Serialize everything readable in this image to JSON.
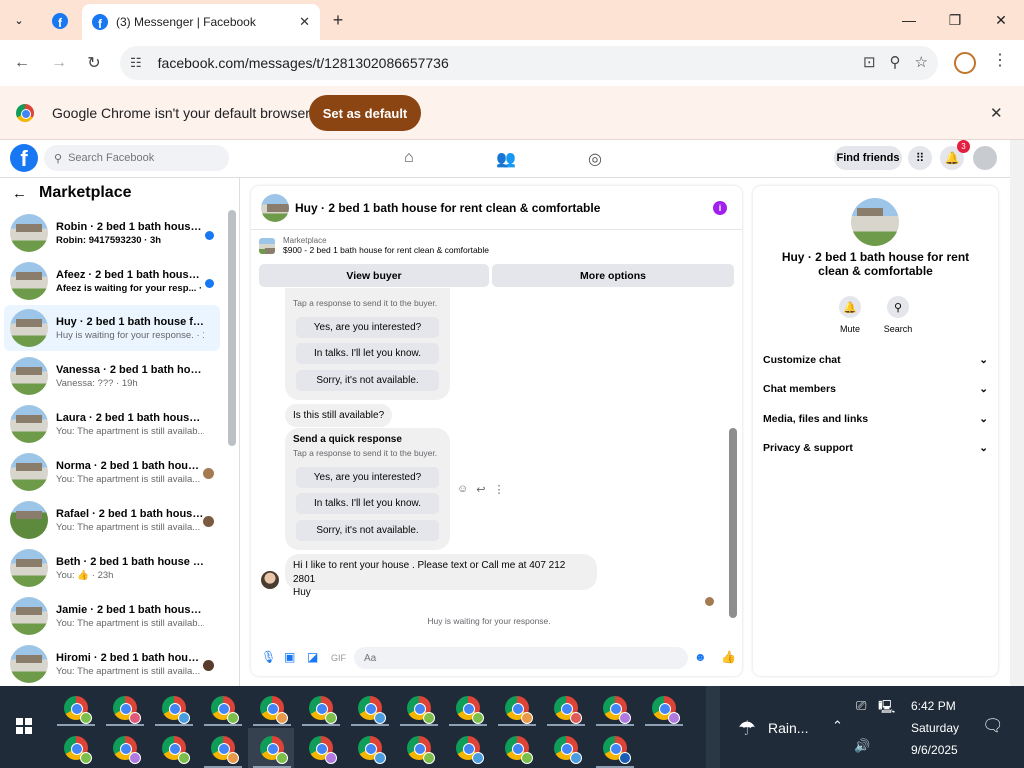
{
  "browser": {
    "tab_title": "(3) Messenger | Facebook",
    "url": "facebook.com/messages/t/1281302086657736",
    "infobar_text": "Google Chrome isn't your default browser",
    "set_default_label": "Set as default"
  },
  "facebook": {
    "search_placeholder": "Search Facebook",
    "find_friends_label": "Find friends",
    "notification_count": "3"
  },
  "sidebar": {
    "title": "Marketplace",
    "conversations": [
      {
        "name": "Robin · 2 bed 1 bath house fo...",
        "sub": "Robin: 9417593230 · 3h",
        "unread": true
      },
      {
        "name": "Afeez · 2 bed 1 bath house fo...",
        "sub": "Afeez is waiting for your resp... · 10h",
        "unread": true
      },
      {
        "name": "Huy · 2 bed 1 bath house for re...",
        "sub": "Huy is waiting for your response. · 11h",
        "unread": false
      },
      {
        "name": "Vanessa · 2 bed 1 bath house fo...",
        "sub": "Vanessa: ??? · 19h",
        "unread": false
      },
      {
        "name": "Laura · 2 bed 1 bath house for r...",
        "sub": "You: The apartment is still availab... · 23h",
        "unread": false
      },
      {
        "name": "Norma · 2 bed 1 bath house f...",
        "sub": "You: The apartment is still availa... · 23h",
        "unread": false
      },
      {
        "name": "Rafael · 2 bed 1 bath house f...",
        "sub": "You: The apartment is still availa... · 23h",
        "unread": false
      },
      {
        "name": "Beth · 2 bed 1 bath house for re...",
        "sub": "You: 👍 · 23h",
        "unread": false
      },
      {
        "name": "Jamie · 2 bed 1 bath house for r...",
        "sub": "You: The apartment is still availab... · 23h",
        "unread": false
      },
      {
        "name": "Hiromi · 2 bed 1 bath house f...",
        "sub": "You: The apartment is still availa... · 23h",
        "unread": false
      }
    ]
  },
  "chat": {
    "title": "Huy · 2 bed 1 bath house for rent clean & comfortable",
    "listing_label": "Marketplace",
    "listing_price": "$900 - 2 bed 1 bath house for rent clean & comfortable",
    "view_buyer_label": "View buyer",
    "more_options_label": "More options",
    "quick_title": "Send a quick response",
    "quick_sub": "Tap a response to send it to the buyer.",
    "quick_options": [
      "Yes, are you interested?",
      "In talks. I'll let you know.",
      "Sorry, it's not available."
    ],
    "still_available": "Is this still available?",
    "last_message_line1": "Hi I like to rent your house . Please text or Call me at 407 212 2801",
    "last_message_line2": "Huy",
    "waiting": "Huy is waiting for your response.",
    "composer_placeholder": "Aa"
  },
  "right_panel": {
    "title": "Huy · 2 bed 1 bath house for rent clean & comfortable",
    "mute_label": "Mute",
    "search_label": "Search",
    "sections": [
      "Customize chat",
      "Chat members",
      "Media, files and links",
      "Privacy & support"
    ]
  },
  "taskbar": {
    "weather": "Rain...",
    "time": "6:42 PM",
    "day": "Saturday",
    "date": "9/6/2025"
  },
  "colors": {
    "facebook_blue": "#1877f2",
    "set_default_bg": "#8b4513",
    "tabbar_bg": "#fde3d4",
    "taskbar_bg": "#1f2b38"
  }
}
